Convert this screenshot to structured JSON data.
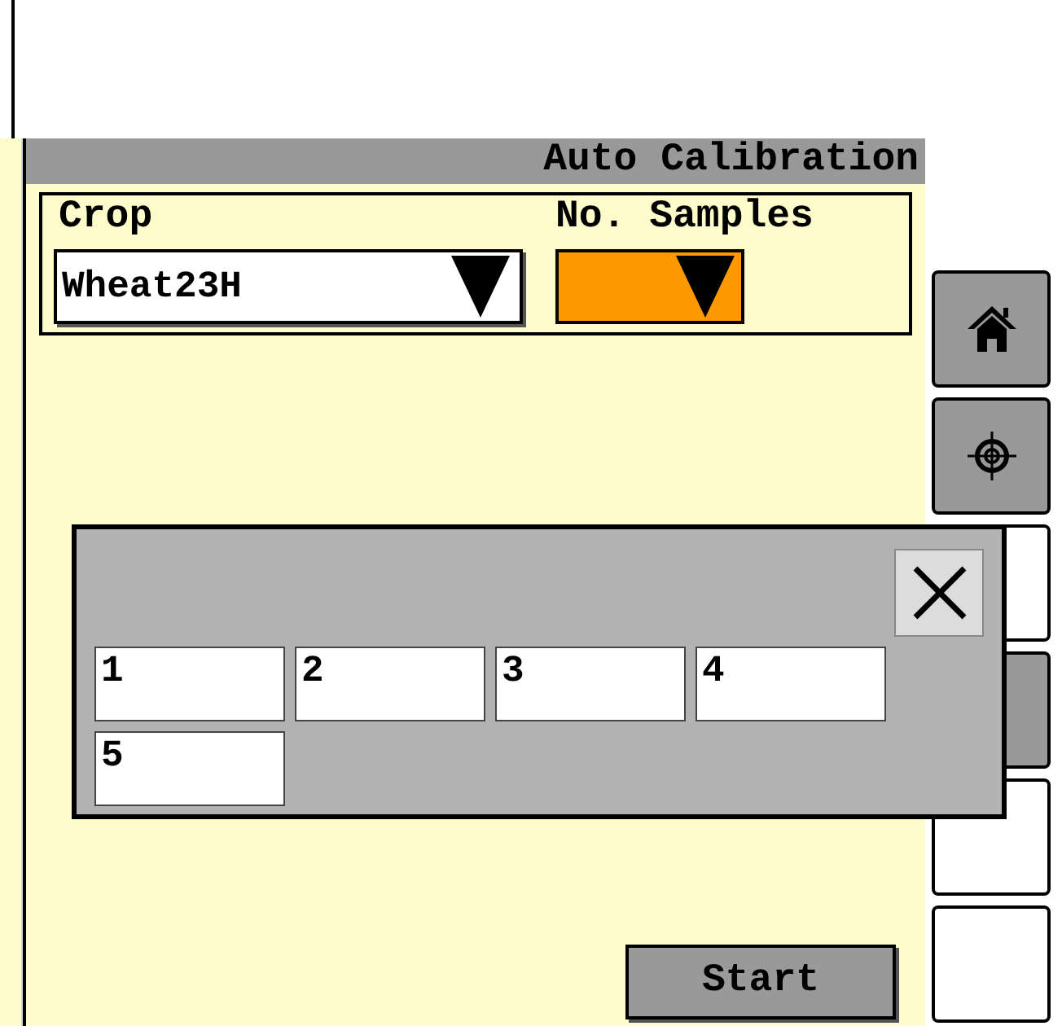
{
  "title": "Auto Calibration",
  "crop": {
    "label": "Crop",
    "value": "Wheat23H"
  },
  "samples": {
    "label": "No. Samples",
    "focused": true
  },
  "start_button": "Start",
  "side_buttons": [
    {
      "kind": "home"
    },
    {
      "kind": "target"
    },
    {
      "kind": "plain"
    },
    {
      "kind": "shaded"
    },
    {
      "kind": "plain"
    },
    {
      "kind": "plain"
    }
  ],
  "popup": {
    "options": [
      "1",
      "2",
      "3",
      "4",
      "5"
    ]
  }
}
